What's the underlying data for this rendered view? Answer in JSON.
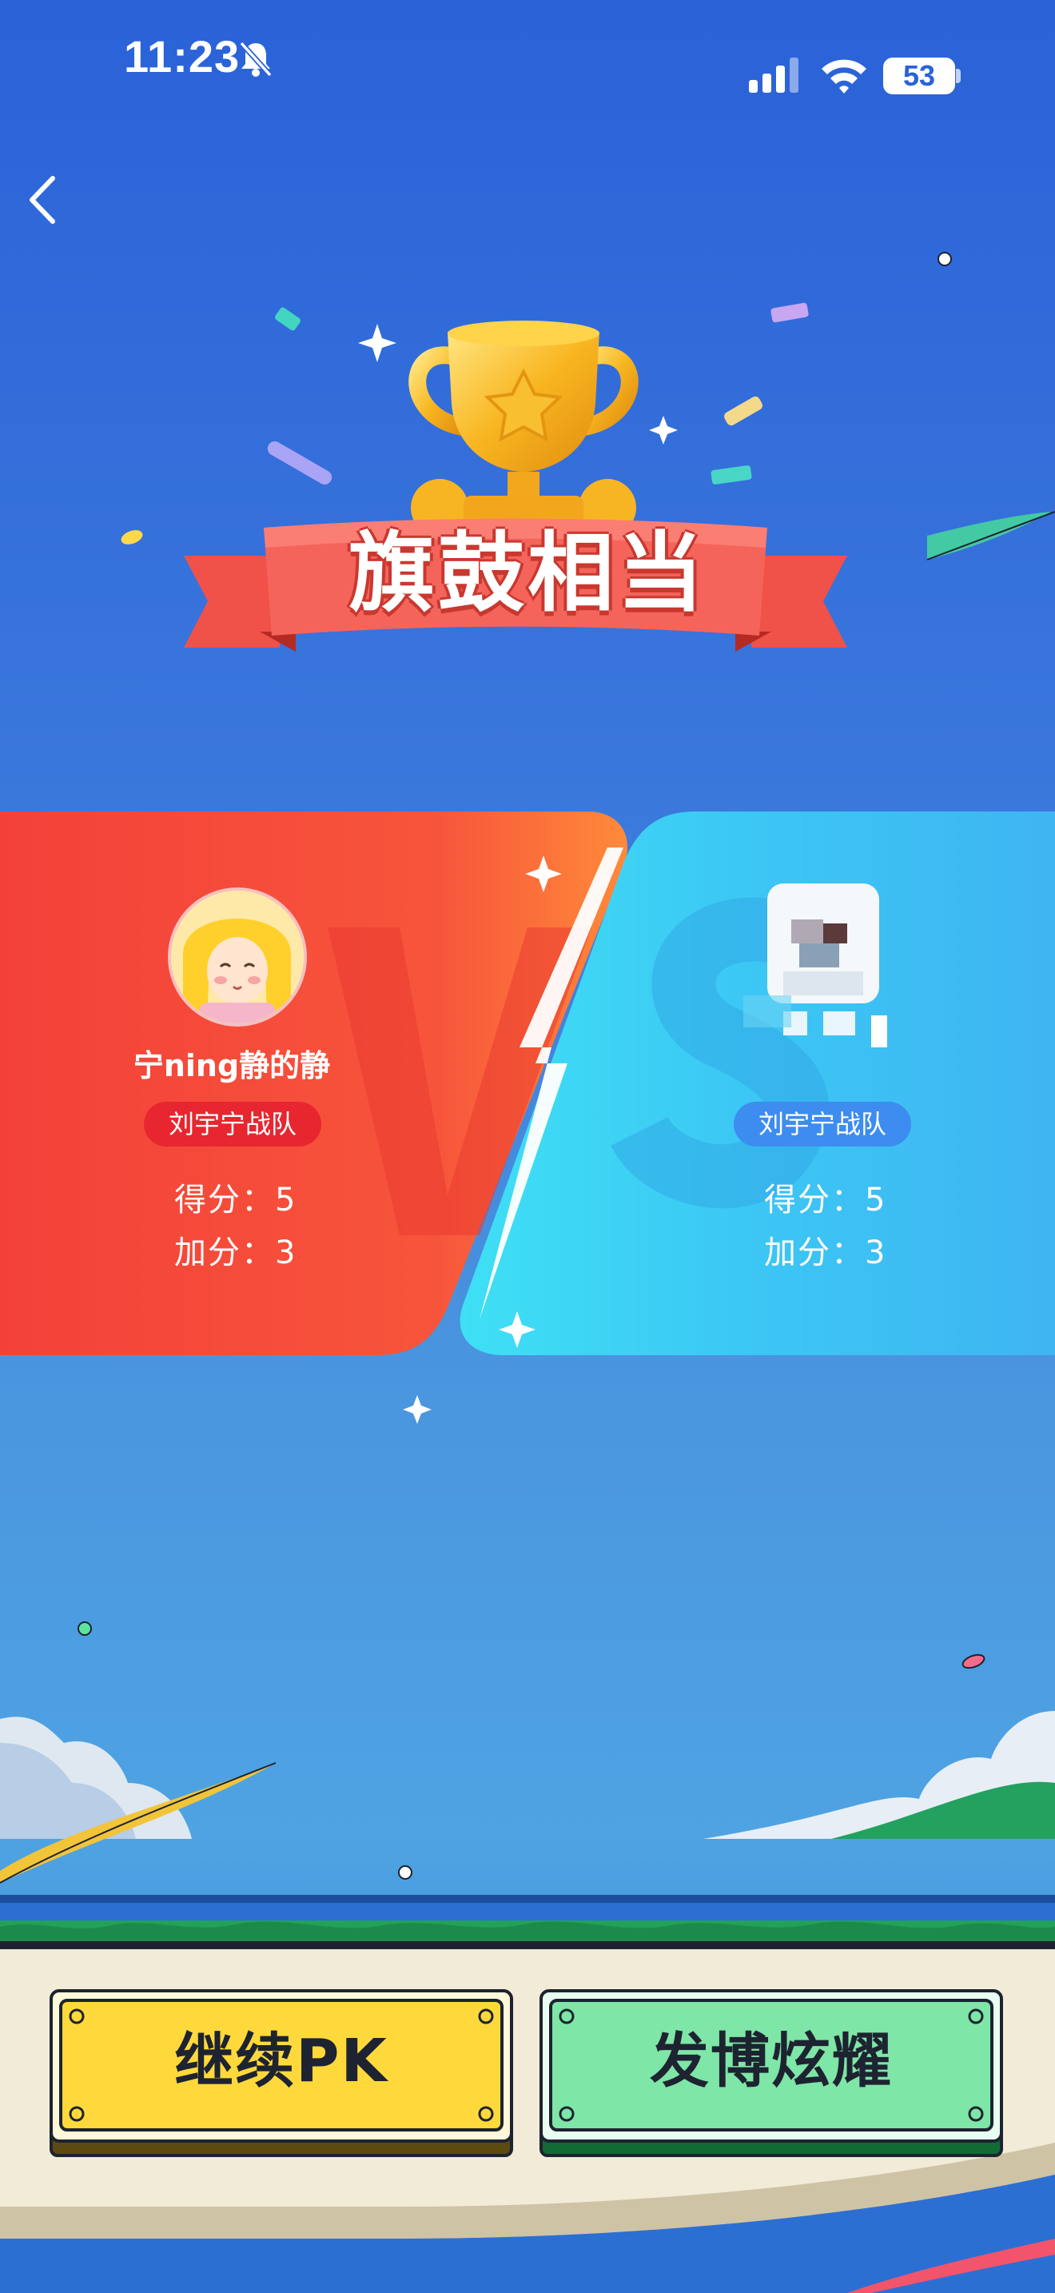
{
  "status_bar": {
    "time": "11:23",
    "battery": "53",
    "bell_icon": "bell-slash-icon",
    "signal_icon": "cellular-signal-icon",
    "wifi_icon": "wifi-icon"
  },
  "header": {
    "back_icon": "chevron-left-icon"
  },
  "result": {
    "title": "旗鼓相当",
    "trophy_icon": "trophy-icon"
  },
  "left_player": {
    "name": "宁ning静的静",
    "team": "刘宇宁战队",
    "score_label": "得分：",
    "score": "5",
    "bonus_label": "加分：",
    "bonus": "3"
  },
  "right_player": {
    "team": "刘宇宁战队",
    "score_label": "得分：",
    "score": "5",
    "bonus_label": "加分：",
    "bonus": "3"
  },
  "actions": {
    "continue_label": "继续PK",
    "share_label": "发博炫耀"
  },
  "colors": {
    "left_panel": "#f5413b",
    "right_panel": "#3fc6f3",
    "continue_button": "#ffd93b",
    "share_button": "#7ee6a6",
    "ribbon": "#f2564c"
  }
}
